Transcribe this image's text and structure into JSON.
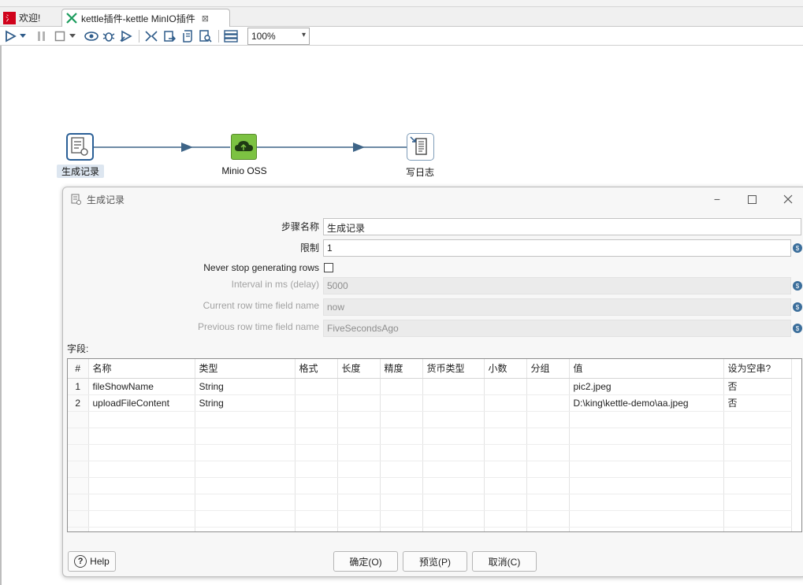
{
  "tabs": [
    {
      "label": "欢迎!",
      "icon": "spoon-icon",
      "color": "#d0021b"
    },
    {
      "label": "kettle插件-kettle MinIO插件",
      "icon": "transformation-icon",
      "close": "⊠"
    }
  ],
  "toolbar": {
    "zoom": "100%",
    "buttons": [
      "run-icon",
      "run-options-icon",
      "pause-icon",
      "stop-icon",
      "stop-options-icon",
      "preview-icon",
      "debug-icon",
      "replay-icon",
      "verify-icon",
      "impact-icon",
      "sql-icon",
      "explore-db-icon",
      "show-results-icon"
    ]
  },
  "canvas": {
    "steps": [
      {
        "label": "生成记录",
        "icon": "generate-rows-icon",
        "selected": true
      },
      {
        "label": "Minio OSS",
        "icon": "minio-cloud-icon",
        "color": "#7cc242"
      },
      {
        "label": "写日志",
        "icon": "write-log-icon"
      }
    ],
    "hop_color": "#3e6487"
  },
  "dialog": {
    "title": "生成记录",
    "step_name_label": "步骤名称",
    "step_name": "生成记录",
    "limit_label": "限制",
    "limit": "1",
    "never_stop_label": "Never stop generating rows",
    "never_stop_checked": false,
    "interval_label": "Interval in ms (delay)",
    "interval": "5000",
    "current_time_label": "Current row time field name",
    "current_time": "now",
    "previous_time_label": "Previous row time field name",
    "previous_time": "FiveSecondsAgo",
    "fields_label": "字段:",
    "columns": [
      "#",
      "名称",
      "类型",
      "格式",
      "长度",
      "精度",
      "货币类型",
      "小数",
      "分组",
      "值",
      "设为空串?"
    ],
    "rows": [
      [
        "1",
        "fileShowName",
        "String",
        "",
        "",
        "",
        "",
        "",
        "",
        "pic2.jpeg",
        "否"
      ],
      [
        "2",
        "uploadFileContent",
        "String",
        "",
        "",
        "",
        "",
        "",
        "",
        "D:\\king\\kettle-demo\\aa.jpeg",
        "否"
      ]
    ],
    "help": "Help",
    "ok": "确定(O)",
    "preview": "预览(P)",
    "cancel": "取消(C)"
  }
}
